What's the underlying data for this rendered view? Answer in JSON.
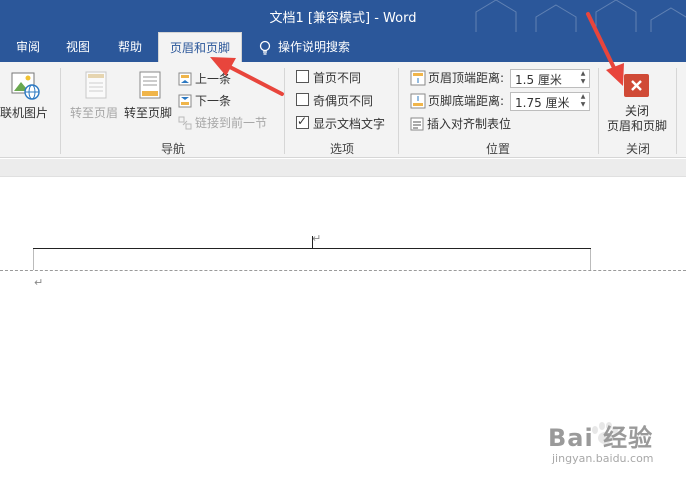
{
  "window": {
    "title": "文档1 [兼容模式]  -  Word"
  },
  "tabs": [
    {
      "label": "审阅",
      "active": false
    },
    {
      "label": "视图",
      "active": false
    },
    {
      "label": "帮助",
      "active": false
    },
    {
      "label": "页眉和页脚",
      "active": true
    },
    {
      "label": "操作说明搜索",
      "active": false
    }
  ],
  "ribbon": {
    "insert": {
      "online_picture": "联机图片"
    },
    "nav": {
      "goto_header": "转至页眉",
      "goto_footer": "转至页脚",
      "previous": "上一条",
      "next": "下一条",
      "link_previous": "链接到前一节",
      "group_label": "导航"
    },
    "options": {
      "different_first_page": "首页不同",
      "different_odd_even": "奇偶页不同",
      "show_document_text": "显示文档文字",
      "different_first_page_checked": false,
      "different_odd_even_checked": false,
      "show_document_text_checked": true,
      "group_label": "选项"
    },
    "position": {
      "header_from_top_label": "页眉顶端距离:",
      "header_from_top_value": "1.5 厘米",
      "footer_from_bottom_label": "页脚底端距离:",
      "footer_from_bottom_value": "1.75 厘米",
      "insert_alignment_tab": "插入对齐制表位",
      "group_label": "位置"
    },
    "close": {
      "label_line1": "关闭",
      "label_line2": "页眉和页脚",
      "group_label": "关闭"
    }
  },
  "document": {
    "paragraph_mark": "↵"
  },
  "watermark": {
    "brand": "Bai  经验",
    "url": "jingyan.baidu.com"
  },
  "colors": {
    "word_blue": "#2b579a",
    "close_red": "#d04a36",
    "arrow_red": "#e8453c"
  }
}
